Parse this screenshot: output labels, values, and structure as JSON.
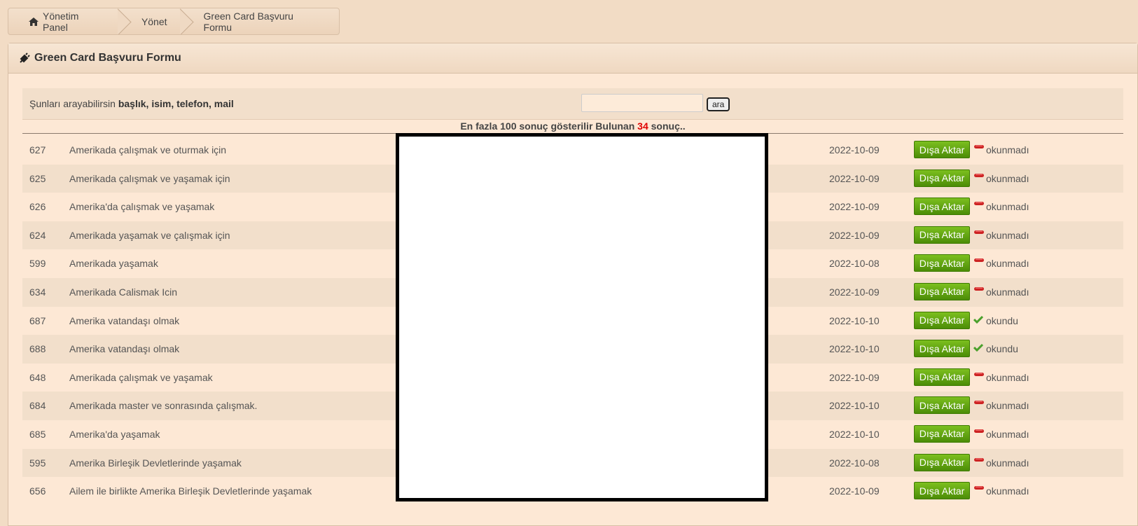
{
  "breadcrumb": {
    "home": "Yönetim Panel",
    "manage": "Yönet",
    "current": "Green Card Başvuru Formu"
  },
  "panel": {
    "title": "Green Card Başvuru Formu"
  },
  "search": {
    "hint_prefix": "Şunları arayabilirsin",
    "hint_fields": "başlık, isim, telefon, mail",
    "input_value": "",
    "button_label": "ara"
  },
  "results": {
    "prefix": "En fazla 100 sonuç gösterilir Bulunan",
    "count": "34",
    "suffix": "sonuç.."
  },
  "export_label": "Dışa Aktar",
  "colors": {
    "accent_green": "#5a9e0e",
    "unread_red": "#cc2222",
    "read_green": "#4aa02c",
    "count_red": "#e00000"
  },
  "rows": [
    {
      "id": "627",
      "title": "Amerikada çalışmak ve oturmak için",
      "date": "2022-10-09",
      "status": "okunmadı",
      "status_icon": "minus-icon"
    },
    {
      "id": "625",
      "title": "Amerikada çalışmak ve yaşamak için",
      "date": "2022-10-09",
      "status": "okunmadı",
      "status_icon": "minus-icon"
    },
    {
      "id": "626",
      "title": "Amerika'da çalışmak ve yaşamak",
      "date": "2022-10-09",
      "status": "okunmadı",
      "status_icon": "minus-icon"
    },
    {
      "id": "624",
      "title": "Amerikada yaşamak ve çalışmak için",
      "date": "2022-10-09",
      "status": "okunmadı",
      "status_icon": "minus-icon"
    },
    {
      "id": "599",
      "title": "Amerikada yaşamak",
      "date": "2022-10-08",
      "status": "okunmadı",
      "status_icon": "minus-icon"
    },
    {
      "id": "634",
      "title": "Amerikada Calismak Icin",
      "date": "2022-10-09",
      "status": "okunmadı",
      "status_icon": "minus-icon"
    },
    {
      "id": "687",
      "title": "Amerika vatandaşı olmak",
      "date": "2022-10-10",
      "status": "okundu",
      "status_icon": "check-icon"
    },
    {
      "id": "688",
      "title": "Amerika vatandaşı olmak",
      "date": "2022-10-10",
      "status": "okundu",
      "status_icon": "check-icon"
    },
    {
      "id": "648",
      "title": "Amerikada çalışmak ve yaşamak",
      "date": "2022-10-09",
      "status": "okunmadı",
      "status_icon": "minus-icon"
    },
    {
      "id": "684",
      "title": "Amerikada master ve sonrasında çalışmak.",
      "date": "2022-10-10",
      "status": "okunmadı",
      "status_icon": "minus-icon"
    },
    {
      "id": "685",
      "title": "Amerika'da yaşamak",
      "date": "2022-10-10",
      "status": "okunmadı",
      "status_icon": "minus-icon"
    },
    {
      "id": "595",
      "title": "Amerika Birleşik Devletlerinde yaşamak",
      "date": "2022-10-08",
      "status": "okunmadı",
      "status_icon": "minus-icon"
    },
    {
      "id": "656",
      "title": "Ailem ile birlikte Amerika Birleşik Devletlerinde yaşamak",
      "date": "2022-10-09",
      "status": "okunmadı",
      "status_icon": "minus-icon"
    }
  ]
}
